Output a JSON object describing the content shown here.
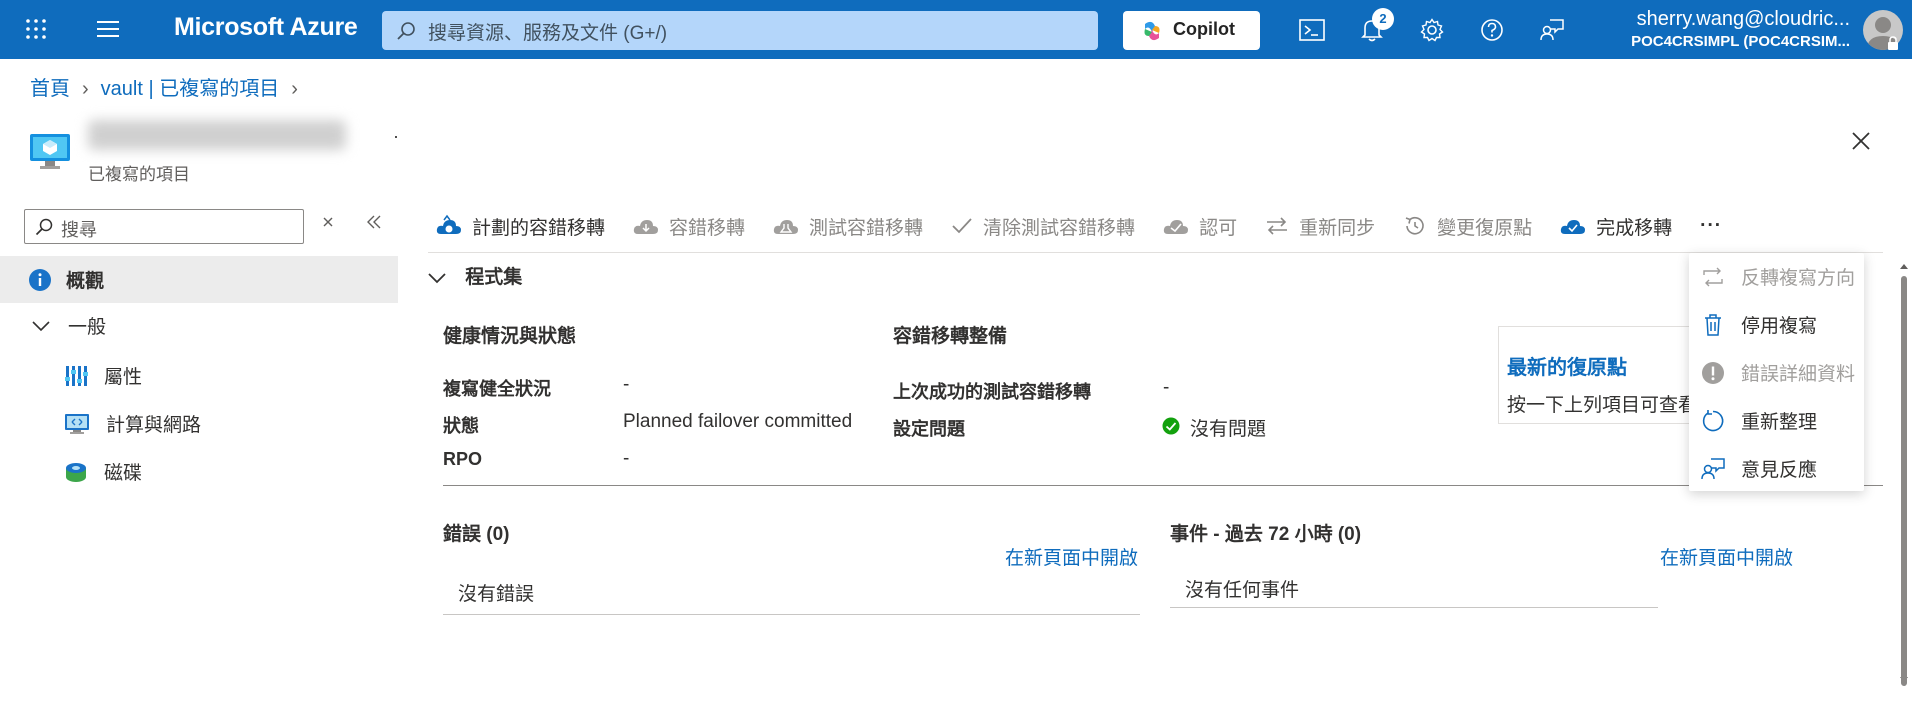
{
  "topbar": {
    "brand": "Microsoft Azure",
    "search_placeholder": "搜尋資源、服務及文件 (G+/)",
    "copilot_label": "Copilot",
    "notification_count": "2",
    "user_email": "sherry.wang@cloudric...",
    "user_tenant": "POC4CRSIMPL (POC4CRSIM..."
  },
  "breadcrumb": {
    "home": "首頁",
    "vault": "vault | 已複寫的項目"
  },
  "page": {
    "subtitle": "已複寫的項目",
    "dot": "·"
  },
  "nav": {
    "search_placeholder": "搜尋",
    "items": [
      {
        "label": "概觀",
        "icon": "info-icon"
      },
      {
        "label": "一般",
        "icon": "chevron-down-icon"
      },
      {
        "label": "屬性",
        "icon": "properties-icon"
      },
      {
        "label": "計算與網路",
        "icon": "network-icon"
      },
      {
        "label": "磁碟",
        "icon": "disk-icon"
      }
    ]
  },
  "commands": [
    {
      "label": "計劃的容錯移轉",
      "icon": "planned-failover-icon",
      "enabled": true
    },
    {
      "label": "容錯移轉",
      "icon": "failover-icon",
      "enabled": false
    },
    {
      "label": "測試容錯移轉",
      "icon": "test-failover-icon",
      "enabled": false
    },
    {
      "label": "清除測試容錯移轉",
      "icon": "check-icon",
      "enabled": false
    },
    {
      "label": "認可",
      "icon": "commit-icon",
      "enabled": false
    },
    {
      "label": "重新同步",
      "icon": "resync-icon",
      "enabled": false
    },
    {
      "label": "變更復原點",
      "icon": "history-icon",
      "enabled": false
    },
    {
      "label": "完成移轉",
      "icon": "complete-migration-icon",
      "enabled": true
    }
  ],
  "more_label": "···",
  "essentials": {
    "title": "程式集",
    "health": {
      "heading": "健康情況與狀態",
      "rows": [
        {
          "label": "複寫健全狀況",
          "value": "-"
        },
        {
          "label": "狀態",
          "value": "Planned failover committed"
        },
        {
          "label": "RPO",
          "value": "-"
        }
      ]
    },
    "readiness": {
      "heading": "容錯移轉整備",
      "rows": [
        {
          "label": "上次成功的測試容錯移轉",
          "value": "-"
        },
        {
          "label": "設定問題",
          "value": "沒有問題"
        }
      ]
    },
    "recovery_card": {
      "title": "最新的復原點",
      "desc": "按一下上列項目可查看"
    }
  },
  "errors": {
    "heading": "錯誤 (0)",
    "open_link": "在新頁面中開啟",
    "empty": "沒有錯誤"
  },
  "events": {
    "heading": "事件 - 過去 72 小時 (0)",
    "open_link": "在新頁面中開啟",
    "empty": "沒有任何事件"
  },
  "dropdown": [
    {
      "label": "反轉複寫方向",
      "icon": "reverse-replication-icon",
      "enabled": false
    },
    {
      "label": "停用複寫",
      "icon": "trash-icon",
      "enabled": true
    },
    {
      "label": "錯誤詳細資料",
      "icon": "error-icon",
      "enabled": false
    },
    {
      "label": "重新整理",
      "icon": "refresh-icon",
      "enabled": true
    },
    {
      "label": "意見反應",
      "icon": "feedback-icon",
      "enabled": true
    }
  ],
  "colors": {
    "accent": "#0f6cbd",
    "success": "#13a10e"
  }
}
